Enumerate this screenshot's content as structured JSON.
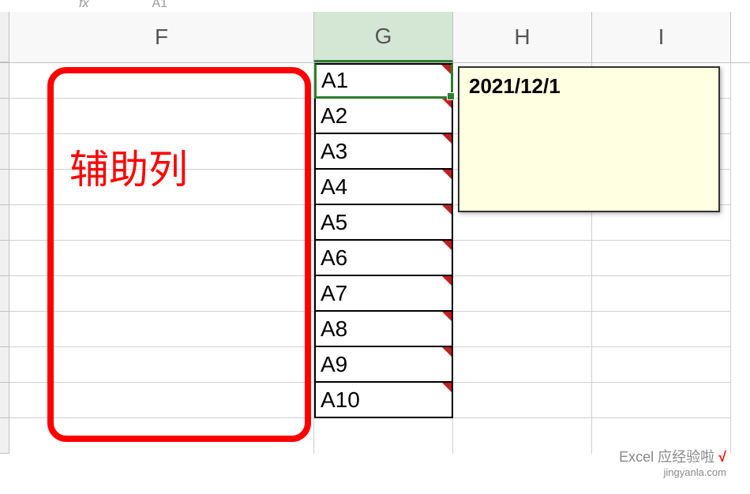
{
  "formula_bar": {
    "fx": "fx",
    "value": "A1"
  },
  "columns": {
    "F": "F",
    "G": "G",
    "H": "H",
    "I": "I"
  },
  "cells": {
    "G": [
      "A1",
      "A2",
      "A3",
      "A4",
      "A5",
      "A6",
      "A7",
      "A8",
      "A9",
      "A10"
    ]
  },
  "comment": {
    "text": "2021/12/1"
  },
  "annotation": {
    "label": "辅助列"
  },
  "watermark": {
    "main": "Excel 应经验啦",
    "sub": "jingyanla.com"
  }
}
